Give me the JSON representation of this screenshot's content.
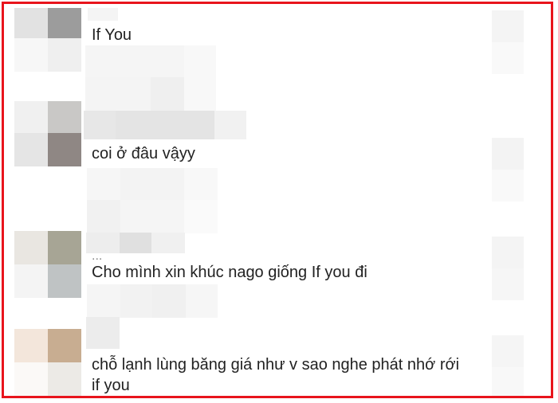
{
  "colors": {
    "border": "#e8141c",
    "text": "#222222",
    "blur_light": "#f3f3f3",
    "blur_mid": "#e6e6e6"
  },
  "comments": [
    {
      "text": "If You"
    },
    {
      "text": "coi ở đâu vậyy"
    },
    {
      "username_fragment": "...",
      "text": "Cho mình xin khúc nago giống If you đi"
    },
    {
      "text": "chỗ lạnh lùng băng giá như v sao nghe phát nhớ rới\nif you"
    }
  ]
}
